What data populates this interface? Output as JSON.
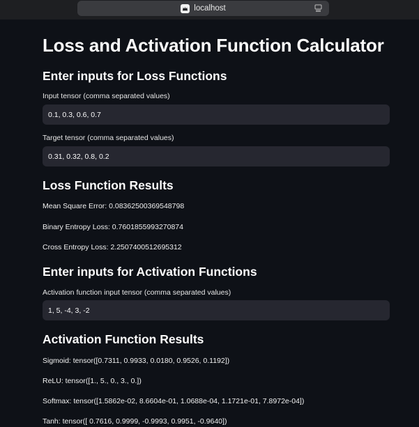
{
  "browser": {
    "url": "localhost"
  },
  "page": {
    "title": "Loss and Activation Function Calculator"
  },
  "loss_inputs": {
    "heading": "Enter inputs for Loss Functions",
    "input_label": "Input tensor (comma separated values)",
    "input_value": "0.1, 0.3, 0.6, 0.7",
    "target_label": "Target tensor (comma separated values)",
    "target_value": "0.31, 0.32, 0.8, 0.2"
  },
  "loss_results": {
    "heading": "Loss Function Results",
    "mse": "Mean Square Error: 0.08362500369548798",
    "bce": "Binary Entropy Loss: 0.7601855993270874",
    "ce": "Cross Entropy Loss: 2.2507400512695312"
  },
  "activation_inputs": {
    "heading": "Enter inputs for Activation Functions",
    "input_label": "Activation function input tensor (comma separated values)",
    "input_value": "1, 5, -4, 3, -2"
  },
  "activation_results": {
    "heading": "Activation Function Results",
    "sigmoid": "Sigmoid: tensor([0.7311, 0.9933, 0.0180, 0.9526, 0.1192])",
    "relu": "ReLU: tensor([1., 5., 0., 3., 0.])",
    "softmax": "Softmax: tensor([1.5862e-02, 8.6604e-01, 1.0688e-04, 1.1721e-01, 7.8972e-04])",
    "tanh": "Tanh: tensor([ 0.7616, 0.9999, -0.9993, 0.9951, -0.9640])"
  }
}
